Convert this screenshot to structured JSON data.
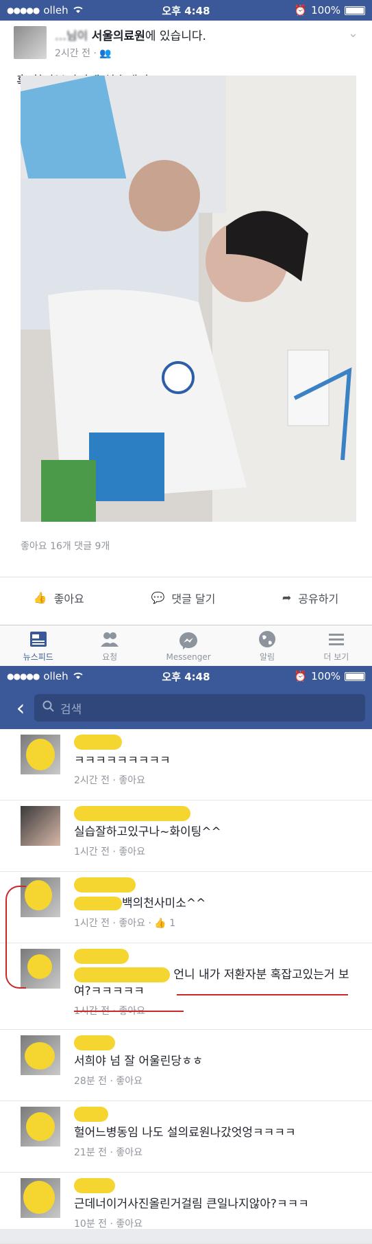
{
  "status_bar": {
    "carrier": "olleh",
    "time": "오후 4:48",
    "battery": "100%"
  },
  "post": {
    "author_partial": "…님이",
    "location": "서울의료원",
    "title_suffix": "에 있습니다.",
    "time": "2시간 전 ·",
    "text": "혹 할아부지덕에 실습잼땅",
    "counts": "좋아요 16개   댓글 9개",
    "actions": [
      "좋아요",
      "댓글 달기",
      "공유하기"
    ]
  },
  "tabs": [
    "뉴스피드",
    "요청",
    "Messenger",
    "알림",
    "더 보기"
  ],
  "search": {
    "placeholder": "검색"
  },
  "comments": [
    {
      "text": "ㅋㅋㅋㅋㅋㅋㅋㅋㅋ",
      "meta": "2시간 전 · 좋아요"
    },
    {
      "text": "실습잘하고있구나~화이팅^^",
      "meta": "1시간 전 · 좋아요"
    },
    {
      "text": "백의천사미소^^",
      "meta": "1시간 전 · 좋아요 · ",
      "likes": "1"
    },
    {
      "text": "언니 내가 저환자분 혹잡고있는거 보여?ㅋㅋㅋㅋㅋ",
      "meta": "1시간 전 · 좋아요"
    },
    {
      "text": "서희야 넘 잘 어울린당ㅎㅎ",
      "meta": "28분 전 · 좋아요"
    },
    {
      "text": "헐어느병동임 나도 설의료원나갔엇엉ㅋㅋㅋㅋ",
      "meta": "21분 전 · 좋아요"
    },
    {
      "text": "근데너이거사진올린거걸림 큰일나지않아?ㅋㅋㅋ",
      "meta": "10분 전 · 좋아요"
    }
  ],
  "colors": {
    "brand": "#3b5998",
    "highlight": "#f5d530",
    "annotation": "#c62828"
  }
}
